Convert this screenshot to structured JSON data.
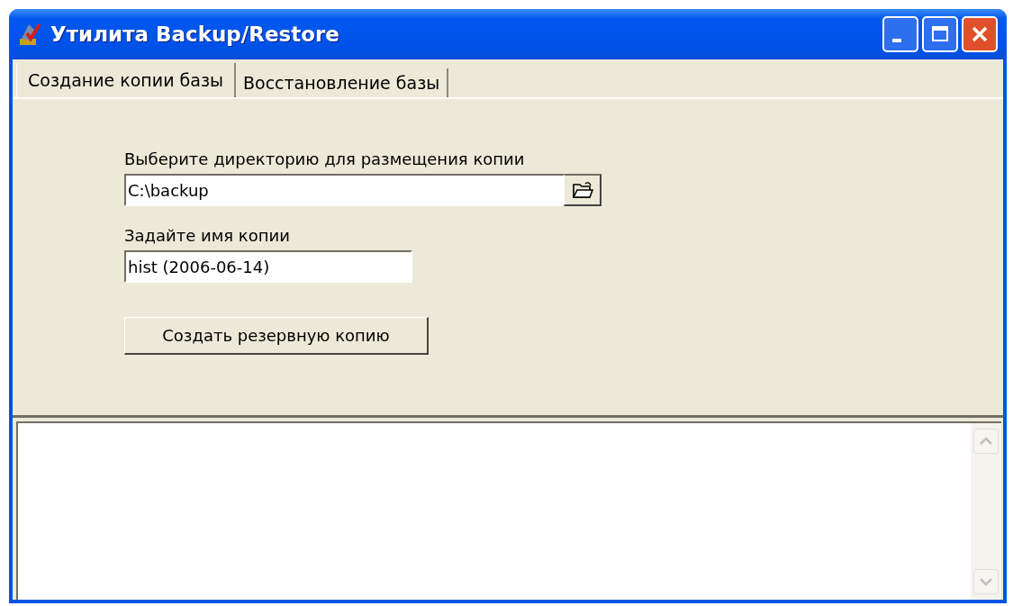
{
  "window": {
    "title": "Утилита Backup/Restore"
  },
  "tabs": [
    {
      "label": "Создание копии базы",
      "selected": true
    },
    {
      "label": "Восстановление базы",
      "selected": false
    }
  ],
  "form": {
    "directory_label": "Выберите директорию для размещения копии",
    "directory_value": "C:\\backup",
    "name_label": "Задайте имя копии",
    "name_value": "hist (2006-06-14)",
    "create_button": "Создать резервную копию"
  }
}
